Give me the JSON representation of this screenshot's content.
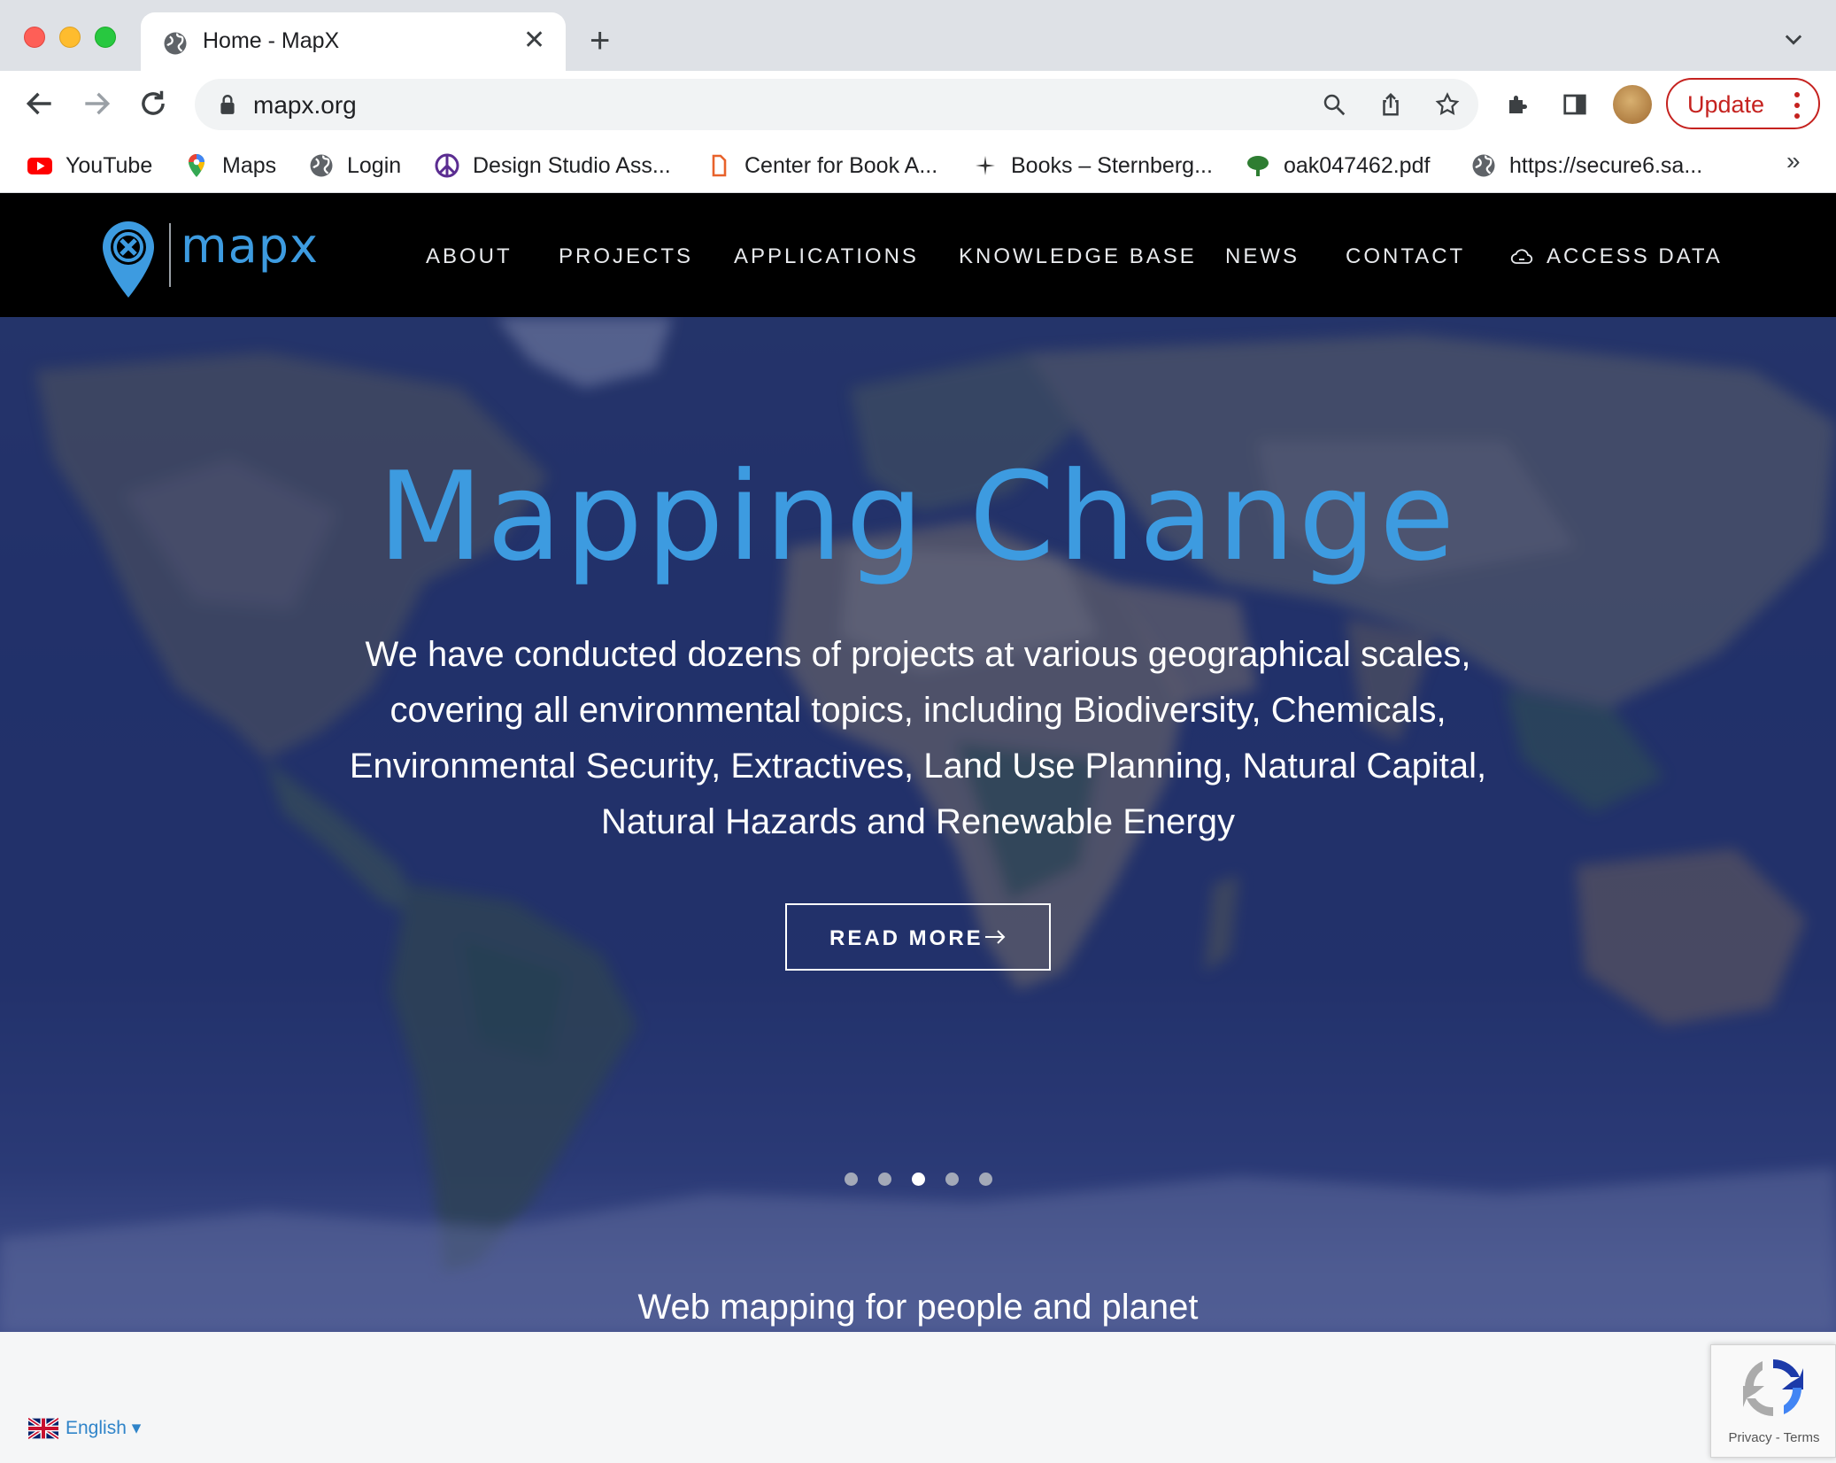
{
  "browser": {
    "tab_title": "Home - MapX",
    "url": "mapx.org",
    "update_label": "Update",
    "bookmarks": [
      {
        "label": "YouTube",
        "icon": "youtube-icon"
      },
      {
        "label": "Maps",
        "icon": "maps-pin-icon"
      },
      {
        "label": "Login",
        "icon": "globe-icon"
      },
      {
        "label": "Design Studio Ass...",
        "icon": "peace-icon"
      },
      {
        "label": "Center for Book A...",
        "icon": "book-icon"
      },
      {
        "label": "Books – Sternberg...",
        "icon": "sparkle-icon"
      },
      {
        "label": "oak047462.pdf",
        "icon": "tree-icon"
      },
      {
        "label": "https://secure6.sa...",
        "icon": "globe-icon"
      }
    ],
    "bookmarks_more": "»"
  },
  "site": {
    "logo_text": "mapx",
    "nav": {
      "about": "ABOUT",
      "projects": "PROJECTS",
      "applications": "APPLICATIONS",
      "knowledge_base": "KNOWLEDGE BASE",
      "news": "NEWS",
      "contact": "CONTACT",
      "access_data": "ACCESS DATA"
    },
    "colors": {
      "accent": "#3d9be0",
      "header_bg": "#000000"
    }
  },
  "hero": {
    "title": "Mapping Change",
    "body": "We have conducted dozens of projects at various geographical scales, covering all environmental topics, including Biodiversity, Chemicals, Environmental Security, Extractives, Land Use Planning, Natural Capital, Natural Hazards and Renewable Energy",
    "cta_label": "READ MORE",
    "slides_total": 5,
    "active_slide": 3,
    "tagline": "Web mapping for people and planet"
  },
  "footer": {
    "language": "English ▾",
    "recaptcha_links": "Privacy - Terms"
  }
}
